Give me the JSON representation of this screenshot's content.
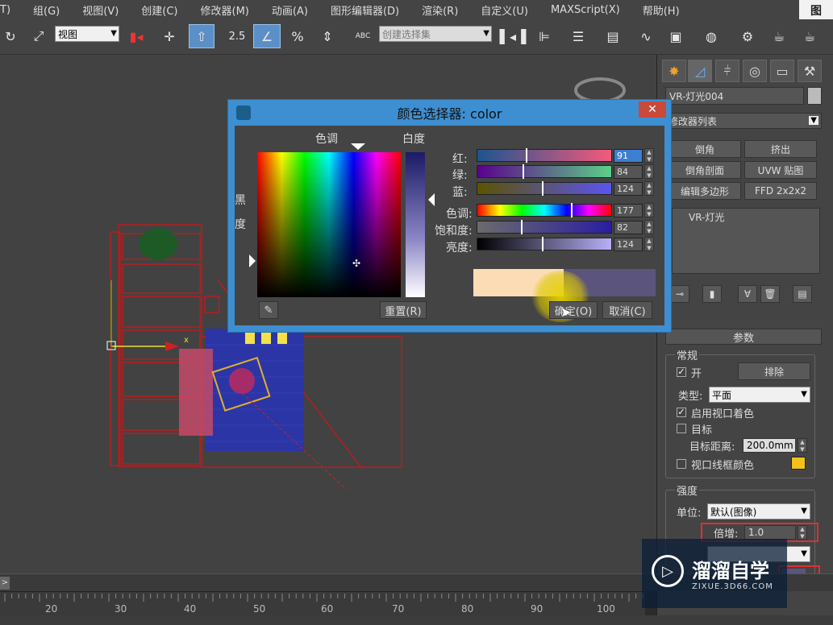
{
  "menubar": {
    "items": [
      "T)",
      "组(G)",
      "视图(V)",
      "创建(C)",
      "修改器(M)",
      "动画(A)",
      "图形编辑器(D)",
      "渲染(R)",
      "自定义(U)",
      "MAXScript(X)",
      "帮助(H)"
    ],
    "corner": "图"
  },
  "toolbar": {
    "view_select": "视图",
    "spinner_snap": "2.5",
    "percent_snap": "%",
    "selection_set": "创建选择集",
    "text_tool": "ABC"
  },
  "dialog": {
    "title": "颜色选择器: color",
    "close": "✕",
    "hue_label": "色调",
    "whiteness_label": "白度",
    "black_label_1": "黑",
    "black_label_2": "度",
    "channels": [
      {
        "label": "红:",
        "value": "91"
      },
      {
        "label": "绿:",
        "value": "84"
      },
      {
        "label": "蓝:",
        "value": "124"
      },
      {
        "label": "色调:",
        "value": "177"
      },
      {
        "label": "饱和度:",
        "value": "82"
      },
      {
        "label": "亮度:",
        "value": "124"
      }
    ],
    "reset_button": "重置(R)",
    "ok_button": "确定(O)",
    "cancel_button": "取消(C)",
    "original_color": "#fcdcb4",
    "new_color": "#5b547c"
  },
  "cmdpanel": {
    "object_name": "VR-灯光004",
    "modifier_list": "修改器列表",
    "buttons": [
      "倒角",
      "挤出",
      "倒角剖面",
      "UVW 贴图",
      "编辑多边形",
      "FFD 2x2x2"
    ],
    "stack_item": "VR-灯光",
    "rollout_title": "参数",
    "general_group": "常规",
    "on_label": "开",
    "exclude_button": "排除",
    "type_label": "类型:",
    "type_value": "平面",
    "viewport_shading": "启用视口着色",
    "target_label": "目标",
    "target_distance_label": "目标距离:",
    "target_distance_value": "200.0mm",
    "wireframe_color": "视口线框颜色",
    "intensity_group": "强度",
    "unit_label": "单位:",
    "unit_value": "默认(图像)",
    "multiplier_label": "倍增:",
    "multiplier_value": "1.0"
  },
  "timeline": {
    "ticks": [
      "20",
      "30",
      "40",
      "50",
      "60",
      "70",
      "80",
      "90",
      "100"
    ],
    "slider_arrow": ">"
  },
  "watermark": {
    "title": "溜溜自学",
    "url": "ZIXUE.3D66.COM"
  }
}
